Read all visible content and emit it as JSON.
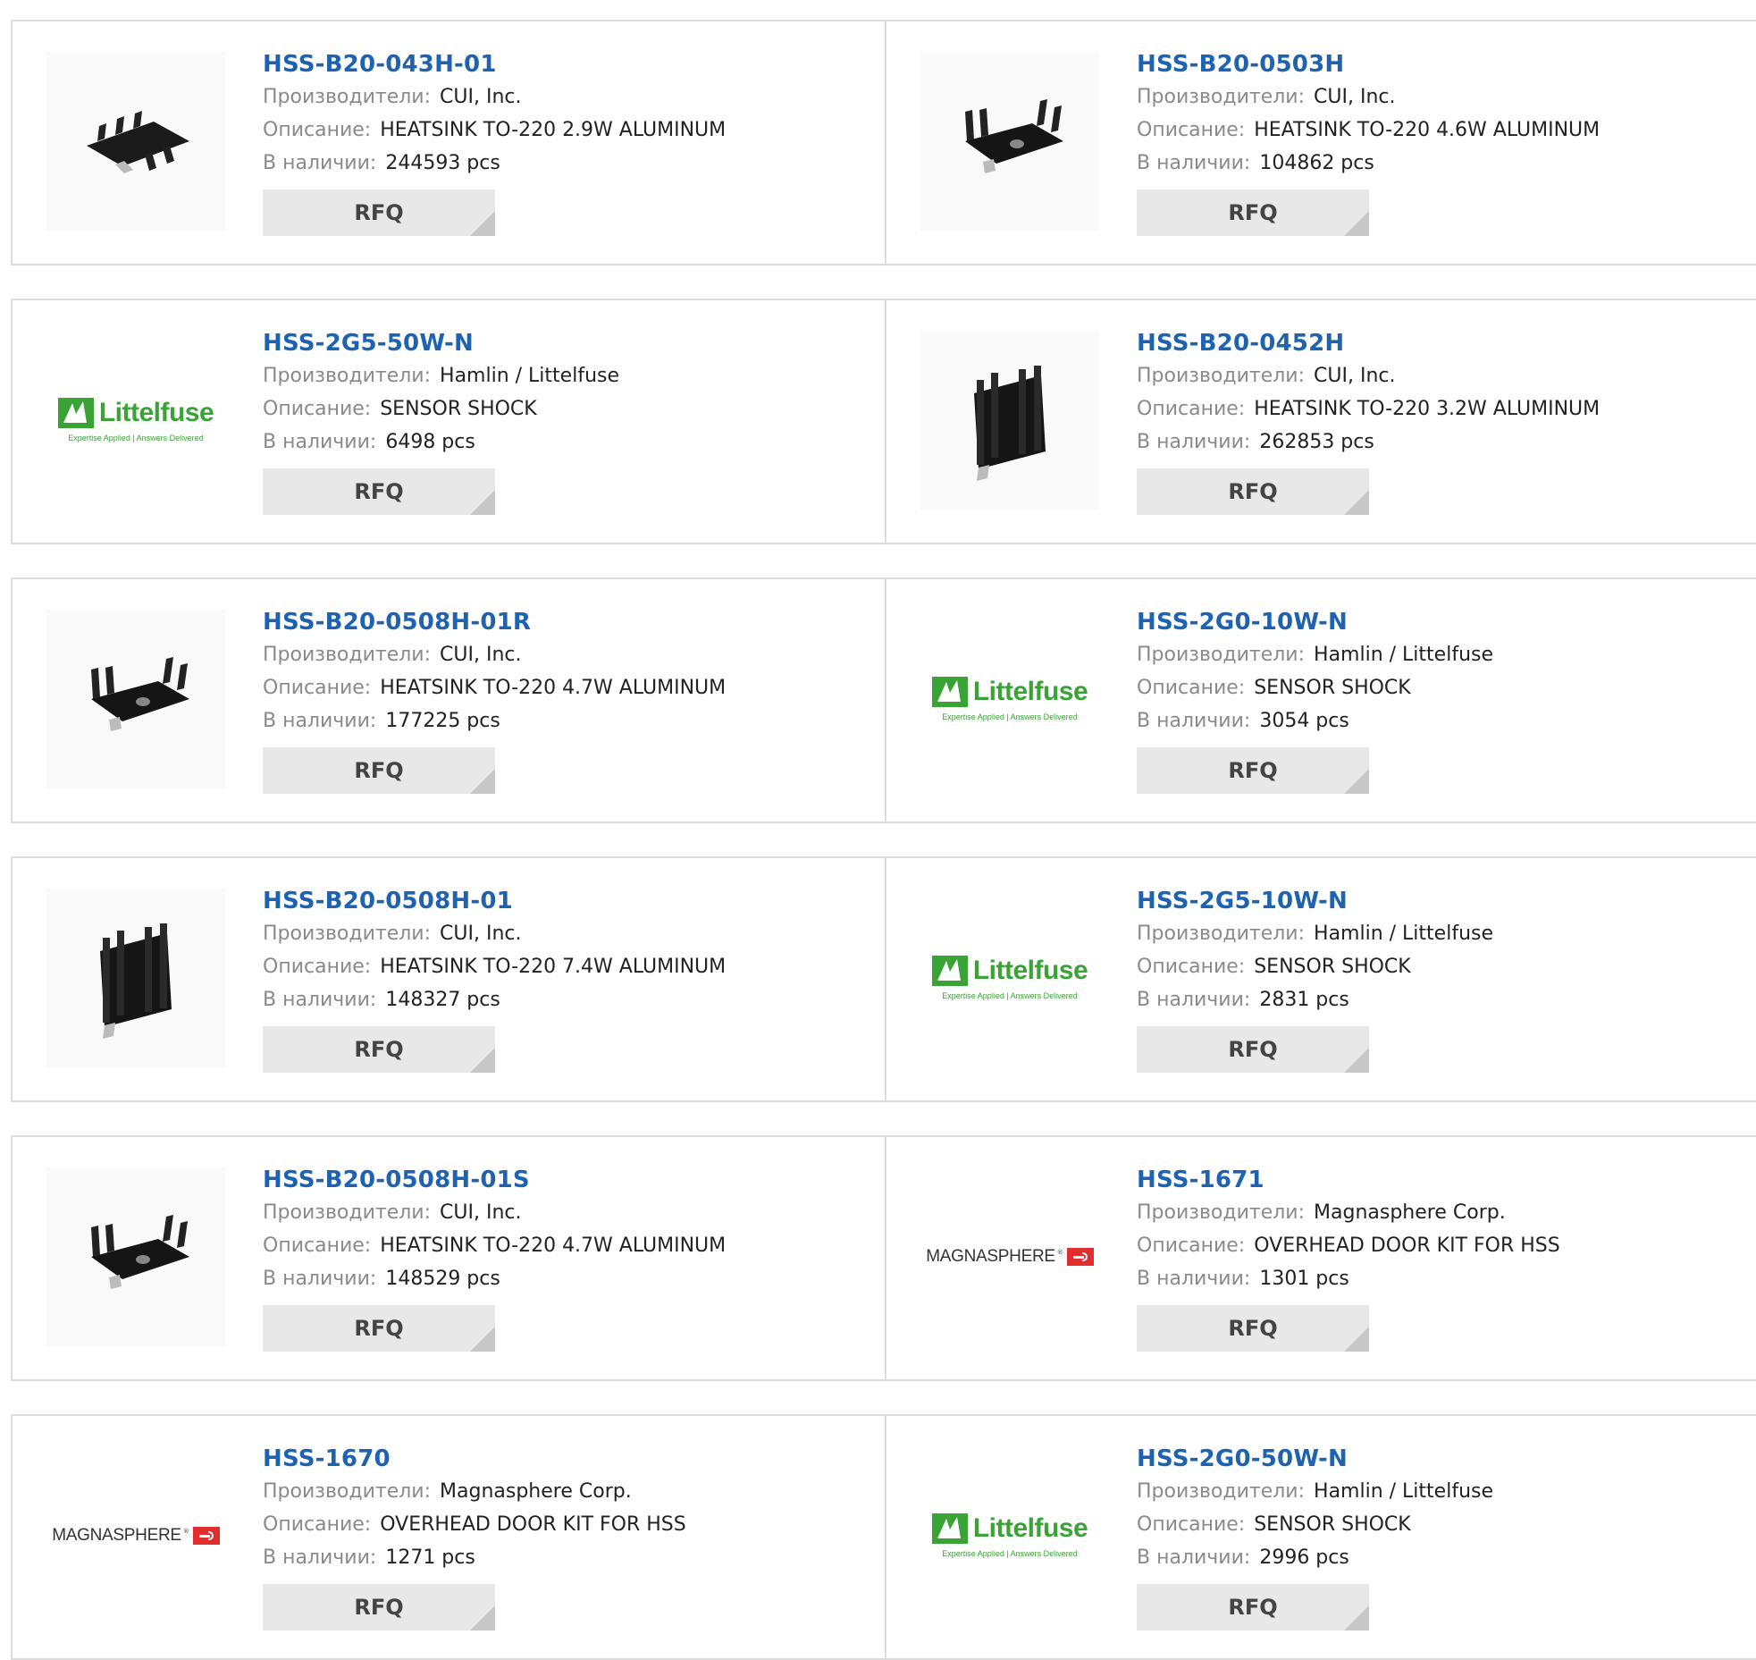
{
  "labels": {
    "manufacturer": "Производители:",
    "description": "Описание:",
    "stock": "В наличии:",
    "rfq": "RFQ"
  },
  "logos": {
    "littelfuse_name": "Littelfuse",
    "littelfuse_tagline": "Expertise Applied | Answers Delivered",
    "magnasphere_name": "MAGNASPHERE"
  },
  "colors": {
    "part_link": "#1f63b0",
    "label_gray": "#8a8a8a",
    "button_bg": "#e8e8e8",
    "littelfuse_green": "#3aa335",
    "magnasphere_red": "#e02e2e"
  },
  "products": [
    {
      "part": "HSS-B20-043H-01",
      "manufacturer": "CUI, Inc.",
      "description": "HEATSINK TO-220 2.9W ALUMINUM",
      "stock": "244593 pcs",
      "image": "heatsink-flat-icon"
    },
    {
      "part": "HSS-B20-0503H",
      "manufacturer": "CUI, Inc.",
      "description": "HEATSINK TO-220 4.6W ALUMINUM",
      "stock": "104862 pcs",
      "image": "heatsink-u-icon"
    },
    {
      "part": "HSS-2G5-50W-N",
      "manufacturer": "Hamlin / Littelfuse",
      "description": "SENSOR SHOCK",
      "stock": "6498 pcs",
      "image": "littelfuse-logo"
    },
    {
      "part": "HSS-B20-0452H",
      "manufacturer": "CUI, Inc.",
      "description": "HEATSINK TO-220 3.2W ALUMINUM",
      "stock": "262853 pcs",
      "image": "heatsink-tall-icon"
    },
    {
      "part": "HSS-B20-0508H-01R",
      "manufacturer": "CUI, Inc.",
      "description": "HEATSINK TO-220 4.7W ALUMINUM",
      "stock": "177225 pcs",
      "image": "heatsink-u-icon"
    },
    {
      "part": "HSS-2G0-10W-N",
      "manufacturer": "Hamlin / Littelfuse",
      "description": "SENSOR SHOCK",
      "stock": "3054 pcs",
      "image": "littelfuse-logo"
    },
    {
      "part": "HSS-B20-0508H-01",
      "manufacturer": "CUI, Inc.",
      "description": "HEATSINK TO-220 7.4W ALUMINUM",
      "stock": "148327 pcs",
      "image": "heatsink-tall-icon"
    },
    {
      "part": "HSS-2G5-10W-N",
      "manufacturer": "Hamlin / Littelfuse",
      "description": "SENSOR SHOCK",
      "stock": "2831 pcs",
      "image": "littelfuse-logo"
    },
    {
      "part": "HSS-B20-0508H-01S",
      "manufacturer": "CUI, Inc.",
      "description": "HEATSINK TO-220 4.7W ALUMINUM",
      "stock": "148529 pcs",
      "image": "heatsink-u-icon"
    },
    {
      "part": "HSS-1671",
      "manufacturer": "Magnasphere Corp.",
      "description": "OVERHEAD DOOR KIT FOR HSS",
      "stock": "1301 pcs",
      "image": "magnasphere-logo"
    },
    {
      "part": "HSS-1670",
      "manufacturer": "Magnasphere Corp.",
      "description": "OVERHEAD DOOR KIT FOR HSS",
      "stock": "1271 pcs",
      "image": "magnasphere-logo"
    },
    {
      "part": "HSS-2G0-50W-N",
      "manufacturer": "Hamlin / Littelfuse",
      "description": "SENSOR SHOCK",
      "stock": "2996 pcs",
      "image": "littelfuse-logo"
    }
  ]
}
